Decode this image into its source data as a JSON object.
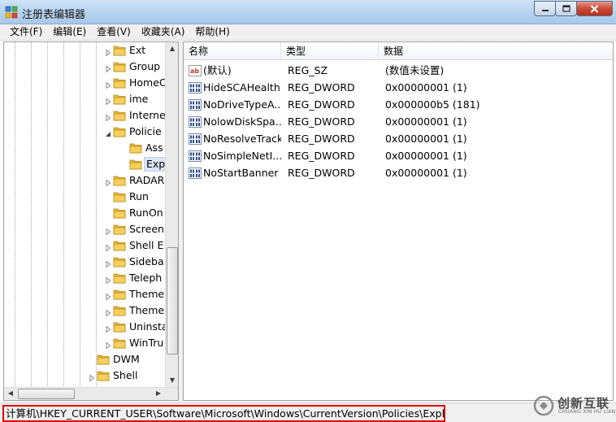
{
  "window": {
    "title": "注册表编辑器"
  },
  "menu": [
    "文件(F)",
    "编辑(E)",
    "查看(V)",
    "收藏夹(A)",
    "帮助(H)"
  ],
  "tree": [
    {
      "label": "Ext",
      "level": 3,
      "expander": "collapsed"
    },
    {
      "label": "Group",
      "level": 3,
      "expander": "collapsed"
    },
    {
      "label": "HomeC",
      "level": 3,
      "expander": "collapsed"
    },
    {
      "label": "ime",
      "level": 3,
      "expander": "collapsed"
    },
    {
      "label": "Interne",
      "level": 3,
      "expander": "collapsed"
    },
    {
      "label": "Policie",
      "level": 3,
      "expander": "expanded"
    },
    {
      "label": "Ass",
      "level": 4,
      "expander": "none"
    },
    {
      "label": "Exp",
      "level": 4,
      "expander": "none",
      "selected": true
    },
    {
      "label": "RADAR",
      "level": 3,
      "expander": "collapsed"
    },
    {
      "label": "Run",
      "level": 3,
      "expander": "none"
    },
    {
      "label": "RunOn",
      "level": 3,
      "expander": "none"
    },
    {
      "label": "Screen",
      "level": 3,
      "expander": "collapsed"
    },
    {
      "label": "Shell E",
      "level": 3,
      "expander": "collapsed"
    },
    {
      "label": "Sideba",
      "level": 3,
      "expander": "collapsed"
    },
    {
      "label": "Teleph",
      "level": 3,
      "expander": "collapsed"
    },
    {
      "label": "Theme",
      "level": 3,
      "expander": "collapsed"
    },
    {
      "label": "Theme",
      "level": 3,
      "expander": "collapsed"
    },
    {
      "label": "Uninsta",
      "level": 3,
      "expander": "collapsed"
    },
    {
      "label": "WinTru",
      "level": 3,
      "expander": "collapsed"
    },
    {
      "label": "DWM",
      "level": 2,
      "expander": "none"
    },
    {
      "label": "Shell",
      "level": 2,
      "expander": "collapsed"
    }
  ],
  "columns": [
    "名称",
    "类型",
    "数据"
  ],
  "values": [
    {
      "name": "(默认)",
      "type": "REG_SZ",
      "data": "(数值未设置)",
      "icon": "string-value-icon"
    },
    {
      "name": "HideSCAHealth",
      "type": "REG_DWORD",
      "data": "0x00000001 (1)",
      "icon": "dword-value-icon"
    },
    {
      "name": "NoDriveTypeA...",
      "type": "REG_DWORD",
      "data": "0x000000b5 (181)",
      "icon": "dword-value-icon"
    },
    {
      "name": "NolowDiskSpa...",
      "type": "REG_DWORD",
      "data": "0x00000001 (1)",
      "icon": "dword-value-icon"
    },
    {
      "name": "NoResolveTrack",
      "type": "REG_DWORD",
      "data": "0x00000001 (1)",
      "icon": "dword-value-icon"
    },
    {
      "name": "NoSimpleNetI...",
      "type": "REG_DWORD",
      "data": "0x00000001 (1)",
      "icon": "dword-value-icon"
    },
    {
      "name": "NoStartBanner",
      "type": "REG_DWORD",
      "data": "0x00000001 (1)",
      "icon": "dword-value-icon"
    }
  ],
  "status": {
    "path": "计算机\\HKEY_CURRENT_USER\\Software\\Microsoft\\Windows\\CurrentVersion\\Policies\\Explorer"
  },
  "watermark": {
    "name": "创新互联",
    "sub": "CHUANG XIN HU LIAN"
  },
  "colors": {
    "highlight_border": "#e00000",
    "folder": "#e8b73a",
    "titlebar": "#b7d3ee"
  }
}
